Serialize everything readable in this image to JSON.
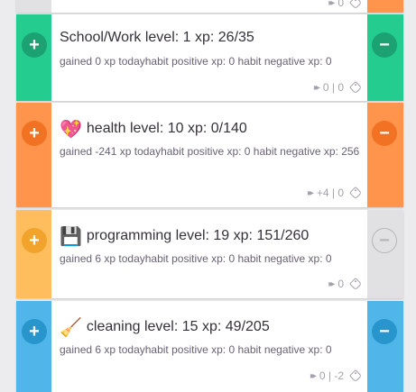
{
  "colors": {
    "page_background": "#ececee",
    "green": "#24cc8f",
    "green_button": "#1ba172",
    "orange": "#ff944c",
    "orange_button": "#f27223",
    "yellow": "#ffbe5d",
    "yellow_button": "#f1a32c",
    "blue": "#50b5e9",
    "blue_button": "#2995cd",
    "gray": "#e1e0e3"
  },
  "tasks": [
    {
      "title": "",
      "notes": "",
      "meta": {
        "counter": "0"
      }
    },
    {
      "title": "School/Work level: 1 xp: 26/35",
      "emoji": "",
      "notes": "gained 0 xp todayhabit positive xp: 0 habit negative xp: 0",
      "meta": {
        "counter": "0 | 0"
      }
    },
    {
      "title": "health level: 10 xp: 0/140",
      "emoji": "💖",
      "notes": "gained -241 xp todayhabit positive xp: 0 habit negative xp: 256",
      "meta": {
        "counter": "+4 | 0"
      }
    },
    {
      "title": "programming level: 19 xp: 151/260",
      "emoji": "💾",
      "notes": "gained 6 xp todayhabit positive xp: 0 habit negative xp: 0",
      "meta": {
        "counter": "0"
      }
    },
    {
      "title": "cleaning level: 15 xp: 49/205",
      "emoji": "🧹",
      "notes": "gained 6 xp todayhabit positive xp: 0 habit negative xp: 0",
      "meta": {
        "counter": "0 | -2"
      }
    }
  ],
  "icons": {
    "plus": "+",
    "minus": "−",
    "streak": "▸▸"
  }
}
